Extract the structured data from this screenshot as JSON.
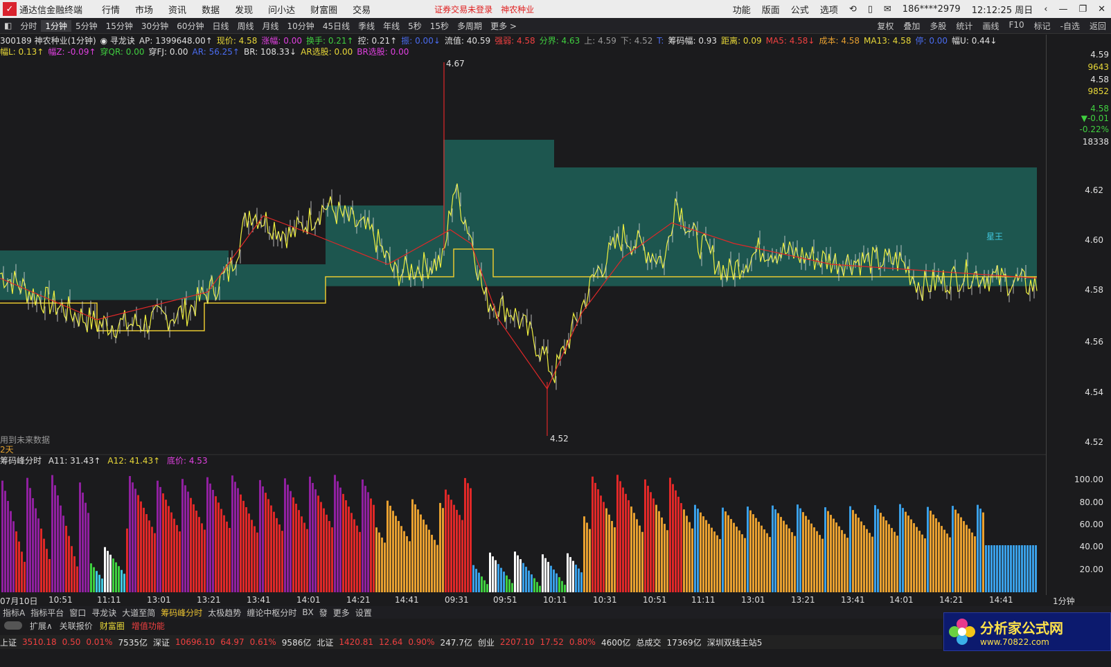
{
  "titlebar": {
    "logo": "✓",
    "app_name": "通达信金融终端",
    "menus": [
      "行情",
      "市场",
      "资讯",
      "数据",
      "发现",
      "问小达",
      "财富圈",
      "交易"
    ],
    "warning": "证券交易未登录",
    "stock_name": "神农种业",
    "right_menus": [
      "功能",
      "版面",
      "公式",
      "选项"
    ],
    "phone": "186****2979",
    "time": "12:12:25 周日"
  },
  "toolbar": {
    "tabs": [
      "分时",
      "1分钟",
      "5分钟",
      "15分钟",
      "30分钟",
      "60分钟",
      "日线",
      "周线",
      "月线",
      "10分钟",
      "45日线",
      "季线",
      "年线",
      "5秒",
      "15秒",
      "多周期",
      "更多 >"
    ],
    "active": "1分钟",
    "right": [
      "复权",
      "叠加",
      "多股",
      "统计",
      "画线",
      "F10",
      "标记",
      "-自选",
      "返回"
    ]
  },
  "info_line1": [
    {
      "t": "300189 神农种业(1分钟)",
      "c": "w"
    },
    {
      "t": "◉ 寻龙诀",
      "c": "w"
    },
    {
      "t": "AP: 1399648.00↑",
      "c": "w"
    },
    {
      "t": "现价: 4.58",
      "c": "y"
    },
    {
      "t": "涨幅: 0.00",
      "c": "m"
    },
    {
      "t": "换手: 0.21↑",
      "c": "g"
    },
    {
      "t": "控: 0.21↑",
      "c": "w"
    },
    {
      "t": "振: 0.00↓",
      "c": "b"
    },
    {
      "t": "流值: 40.59",
      "c": "w"
    },
    {
      "t": "强弱: 4.58",
      "c": "r"
    },
    {
      "t": "分界: 4.63",
      "c": "g"
    },
    {
      "t": "上: 4.59",
      "c": "gr"
    },
    {
      "t": "下: 4.52",
      "c": "gr"
    },
    {
      "t": "T:",
      "c": "b"
    },
    {
      "t": "筹码幅: 0.93",
      "c": "w"
    },
    {
      "t": "距离: 0.09",
      "c": "y"
    },
    {
      "t": "MA5: 4.58↓",
      "c": "r"
    },
    {
      "t": "成本: 4.58",
      "c": "o"
    },
    {
      "t": "MA13: 4.58",
      "c": "y"
    },
    {
      "t": "停: 0.00",
      "c": "b"
    },
    {
      "t": "幅U: 0.44↓",
      "c": "w"
    }
  ],
  "info_line2": [
    {
      "t": "幅L: 0.13↑",
      "c": "y"
    },
    {
      "t": "幅Z: -0.09↑",
      "c": "m"
    },
    {
      "t": "穿QR: 0.00",
      "c": "g"
    },
    {
      "t": "穿FJ: 0.00",
      "c": "w"
    },
    {
      "t": "AR: 56.25↑",
      "c": "b"
    },
    {
      "t": "BR: 108.33↓",
      "c": "w"
    },
    {
      "t": "AR选股: 0.00",
      "c": "y"
    },
    {
      "t": "BR选股: 0.00",
      "c": "m"
    }
  ],
  "price_axis": [
    "4.62",
    "4.60",
    "4.58",
    "4.56",
    "4.54",
    "4.52"
  ],
  "right_panel": [
    {
      "t": "4.59",
      "c": "w"
    },
    {
      "t": "9643",
      "c": "y"
    },
    {
      "t": "4.58",
      "c": "w"
    },
    {
      "t": "9852",
      "c": "y"
    },
    {
      "t": "4.58",
      "c": "g"
    },
    {
      "t": "▼-0.01",
      "c": "g"
    },
    {
      "t": "-0.22%",
      "c": "g"
    },
    {
      "t": "18338",
      "c": "w"
    }
  ],
  "annotations": {
    "high": "4.67",
    "low": "4.52",
    "future_note": "用到未来数据",
    "days_note": "2天",
    "star_label": "星王"
  },
  "indicator": {
    "name": "筹码峰分时",
    "a11": "A11: 31.43↑",
    "a12": "A12: 41.43↑",
    "low_price": "底价: 4.53",
    "axis": [
      "100.00",
      "80.00",
      "60.00",
      "40.00",
      "20.00"
    ]
  },
  "time_axis": [
    "07月10日",
    "10:51",
    "11:11",
    "13:01",
    "13:21",
    "13:41",
    "14:01",
    "14:21",
    "14:41",
    "09:31",
    "09:51",
    "10:11",
    "10:31",
    "10:51",
    "11:11",
    "13:01",
    "13:21",
    "13:41",
    "14:01",
    "14:21",
    "14:41"
  ],
  "period_label": "1分钟",
  "bottom_tabs": [
    "指标A",
    "指标平台",
    "窗口",
    "寻龙诀",
    "大道至简",
    "筹码峰分时",
    "太极趋势",
    "缠论中枢分时",
    "BX",
    "發",
    "更多",
    "设置"
  ],
  "bottom_tabs_active": "筹码峰分时",
  "bottom_tabs2": [
    "扩展∧",
    "关联报价",
    "财富圈",
    "增值功能"
  ],
  "status": [
    {
      "t": "上证",
      "c": "w"
    },
    {
      "t": "3510.18",
      "c": "r"
    },
    {
      "t": "0.50",
      "c": "r"
    },
    {
      "t": "0.01%",
      "c": "r"
    },
    {
      "t": "7535亿",
      "c": "w"
    },
    {
      "t": "深证",
      "c": "w"
    },
    {
      "t": "10696.10",
      "c": "r"
    },
    {
      "t": "64.97",
      "c": "r"
    },
    {
      "t": "0.61%",
      "c": "r"
    },
    {
      "t": "9586亿",
      "c": "w"
    },
    {
      "t": "北证",
      "c": "w"
    },
    {
      "t": "1420.81",
      "c": "r"
    },
    {
      "t": "12.64",
      "c": "r"
    },
    {
      "t": "0.90%",
      "c": "r"
    },
    {
      "t": "247.7亿",
      "c": "w"
    },
    {
      "t": "创业",
      "c": "w"
    },
    {
      "t": "2207.10",
      "c": "r"
    },
    {
      "t": "17.52",
      "c": "r"
    },
    {
      "t": "0.80%",
      "c": "r"
    },
    {
      "t": "4600亿",
      "c": "w"
    },
    {
      "t": "总成交",
      "c": "w"
    },
    {
      "t": "17369亿",
      "c": "w"
    },
    {
      "t": "深圳双线主站5",
      "c": "w"
    }
  ],
  "watermark": {
    "title": "分析家公式网",
    "url": "www.70822.com"
  }
}
